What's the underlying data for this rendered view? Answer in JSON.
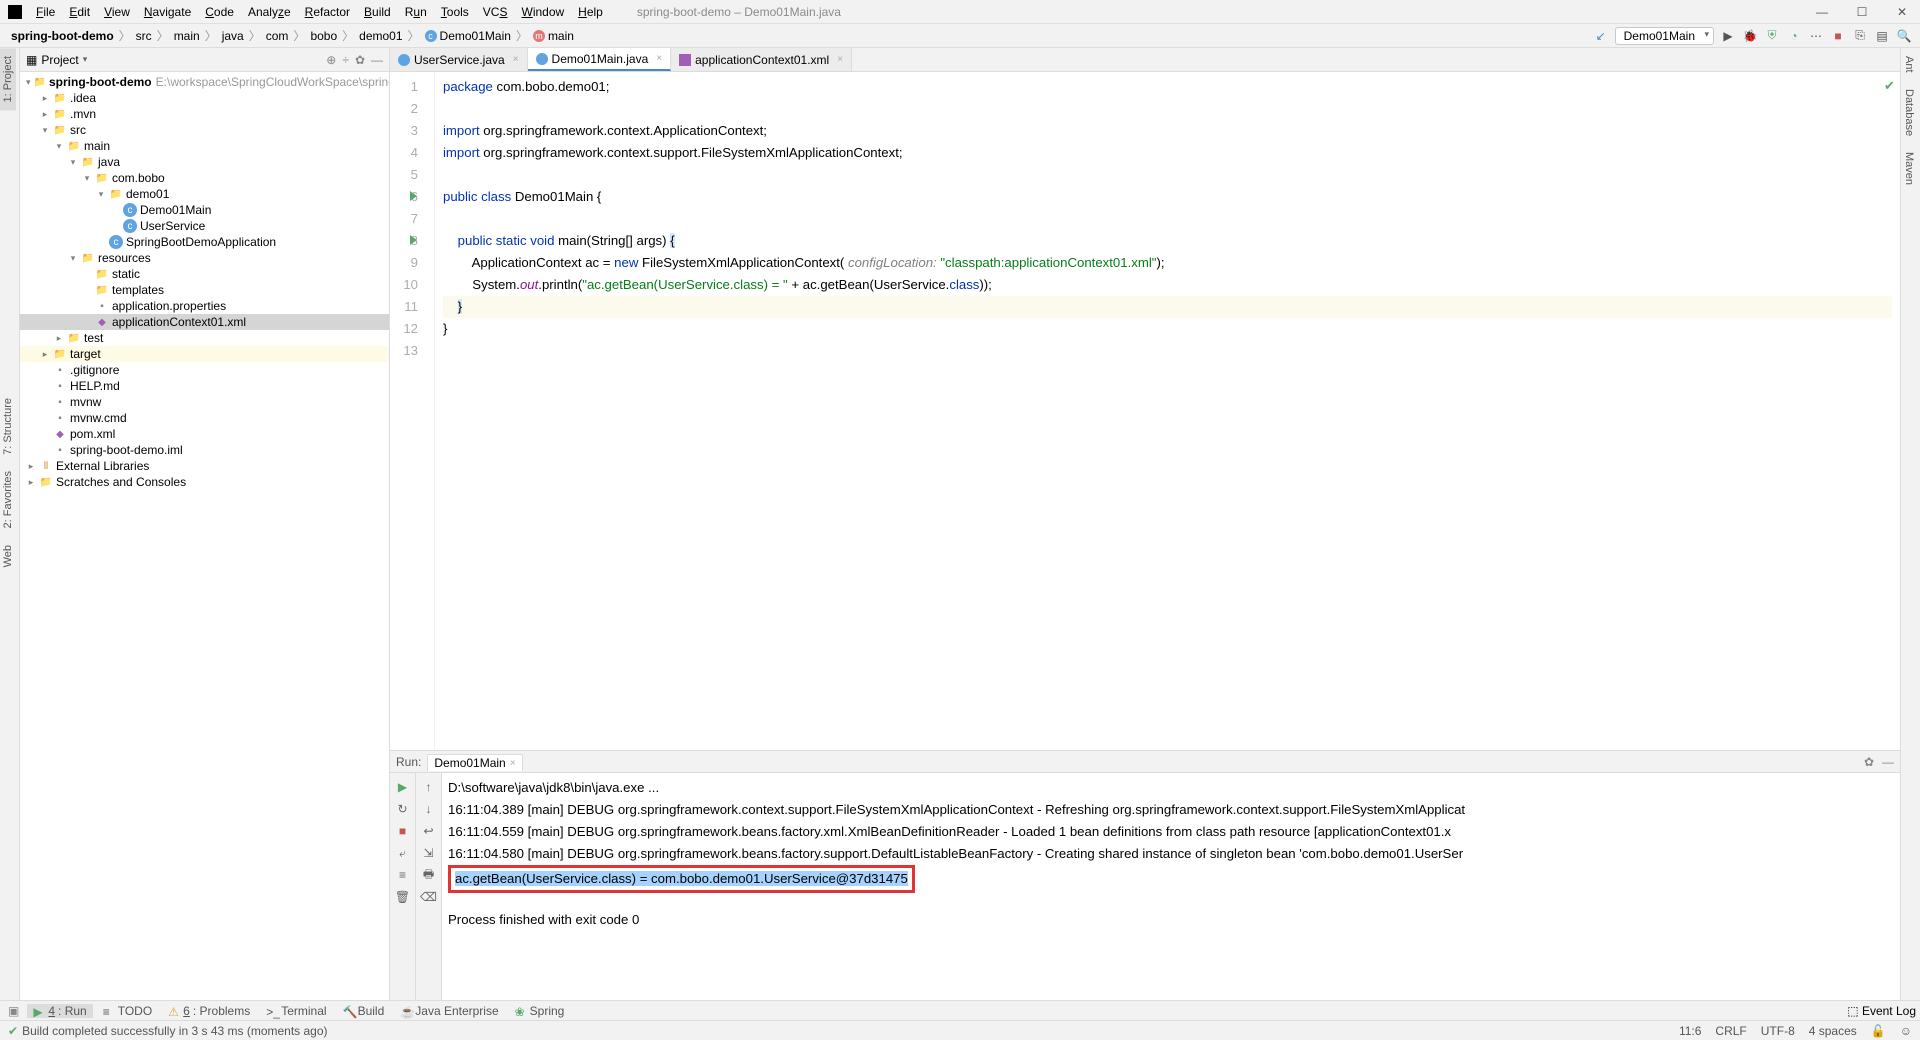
{
  "title": "spring-boot-demo – Demo01Main.java",
  "menus": [
    "File",
    "Edit",
    "View",
    "Navigate",
    "Code",
    "Analyze",
    "Refactor",
    "Build",
    "Run",
    "Tools",
    "VCS",
    "Window",
    "Help"
  ],
  "breadcrumb": {
    "project": "spring-boot-demo",
    "parts": [
      "src",
      "main",
      "java",
      "com",
      "bobo",
      "demo01"
    ],
    "class": "Demo01Main",
    "method": "main"
  },
  "run_config": "Demo01Main",
  "left_vtabs": [
    "1: Project",
    "7: Structure",
    "2: Favorites",
    "Web"
  ],
  "right_vtabs": [
    "Ant",
    "Database",
    "Maven"
  ],
  "project_panel": {
    "title": "Project"
  },
  "tree": [
    {
      "indent": 0,
      "exp": "▾",
      "icontype": "folder",
      "label": "spring-boot-demo",
      "path": "E:\\workspace\\SpringCloudWorkSpace\\spring-boot-d",
      "bold": true
    },
    {
      "indent": 1,
      "exp": "▸",
      "icontype": "folder",
      "label": ".idea"
    },
    {
      "indent": 1,
      "exp": "▸",
      "icontype": "folder",
      "label": ".mvn"
    },
    {
      "indent": 1,
      "exp": "▾",
      "icontype": "folder-blue",
      "label": "src"
    },
    {
      "indent": 2,
      "exp": "▾",
      "icontype": "folder",
      "label": "main"
    },
    {
      "indent": 3,
      "exp": "▾",
      "icontype": "folder-blue",
      "label": "java"
    },
    {
      "indent": 4,
      "exp": "▾",
      "icontype": "folder",
      "label": "com.bobo"
    },
    {
      "indent": 5,
      "exp": "▾",
      "icontype": "folder",
      "label": "demo01"
    },
    {
      "indent": 6,
      "exp": "",
      "icontype": "class",
      "label": "Demo01Main"
    },
    {
      "indent": 6,
      "exp": "",
      "icontype": "class",
      "label": "UserService"
    },
    {
      "indent": 5,
      "exp": "",
      "icontype": "class",
      "label": "SpringBootDemoApplication"
    },
    {
      "indent": 3,
      "exp": "▾",
      "icontype": "folder-orange",
      "label": "resources"
    },
    {
      "indent": 4,
      "exp": "",
      "icontype": "folder",
      "label": "static"
    },
    {
      "indent": 4,
      "exp": "",
      "icontype": "folder",
      "label": "templates"
    },
    {
      "indent": 4,
      "exp": "",
      "icontype": "file",
      "label": "application.properties"
    },
    {
      "indent": 4,
      "exp": "",
      "icontype": "xml",
      "label": "applicationContext01.xml",
      "selected": true
    },
    {
      "indent": 2,
      "exp": "▸",
      "icontype": "folder",
      "label": "test"
    },
    {
      "indent": 1,
      "exp": "▸",
      "icontype": "folder-orange",
      "label": "target",
      "warnbg": true
    },
    {
      "indent": 1,
      "exp": "",
      "icontype": "file",
      "label": ".gitignore"
    },
    {
      "indent": 1,
      "exp": "",
      "icontype": "file",
      "label": "HELP.md"
    },
    {
      "indent": 1,
      "exp": "",
      "icontype": "file",
      "label": "mvnw"
    },
    {
      "indent": 1,
      "exp": "",
      "icontype": "file",
      "label": "mvnw.cmd"
    },
    {
      "indent": 1,
      "exp": "",
      "icontype": "xml",
      "label": "pom.xml"
    },
    {
      "indent": 1,
      "exp": "",
      "icontype": "file",
      "label": "spring-boot-demo.iml"
    },
    {
      "indent": 0,
      "exp": "▸",
      "icontype": "lib",
      "label": "External Libraries"
    },
    {
      "indent": 0,
      "exp": "▸",
      "icontype": "folder",
      "label": "Scratches and Consoles"
    }
  ],
  "editor_tabs": [
    {
      "name": "UserService.java",
      "type": "cl"
    },
    {
      "name": "Demo01Main.java",
      "type": "cl",
      "active": true
    },
    {
      "name": "applicationContext01.xml",
      "type": "xm"
    }
  ],
  "code": {
    "lines": [
      {
        "n": 1,
        "type": "pkg"
      },
      {
        "n": 2,
        "type": "blank"
      },
      {
        "n": 3,
        "type": "imp1"
      },
      {
        "n": 4,
        "type": "imp2"
      },
      {
        "n": 5,
        "type": "blank"
      },
      {
        "n": 6,
        "type": "class",
        "run": true
      },
      {
        "n": 7,
        "type": "blank"
      },
      {
        "n": 8,
        "type": "main",
        "run": true
      },
      {
        "n": 9,
        "type": "ac"
      },
      {
        "n": 10,
        "type": "sout"
      },
      {
        "n": 11,
        "type": "close1",
        "hl": true
      },
      {
        "n": 12,
        "type": "close2"
      },
      {
        "n": 13,
        "type": "blank"
      }
    ],
    "pkg_kw": "package",
    "pkg_val": " com.bobo.demo01;",
    "imp_kw": "import",
    "imp1_val": " org.springframework.context.ApplicationContext;",
    "imp2_val": " org.springframework.context.support.FileSystemXmlApplicationContext;",
    "class_decl_kw": "public class ",
    "class_name": "Demo01Main {",
    "main_kw1": "public static void ",
    "main_name": "main",
    "main_args": "(String[] args) ",
    "main_brace": "{",
    "ac_line_pre": "        ApplicationContext ac = ",
    "ac_new": "new",
    "ac_ctor": " FileSystemXmlApplicationContext( ",
    "ac_param": "configLocation:",
    "ac_str": " \"classpath:applicationContext01.xml\"",
    "ac_end": ");",
    "sout_pre": "        System.",
    "sout_out": "out",
    "sout_mid": ".println(",
    "sout_str": "\"ac.getBean(UserService.class) = \"",
    "sout_post": " + ac.getBean(UserService.",
    "sout_cls": "class",
    "sout_end": "));",
    "close1": "    ",
    "close1_brace": "}",
    "close2": "}"
  },
  "run_panel": {
    "label": "Run:",
    "tab": "Demo01Main"
  },
  "console": [
    "D:\\software\\java\\jdk8\\bin\\java.exe ...",
    "16:11:04.389 [main] DEBUG org.springframework.context.support.FileSystemXmlApplicationContext - Refreshing org.springframework.context.support.FileSystemXmlApplicat",
    "16:11:04.559 [main] DEBUG org.springframework.beans.factory.xml.XmlBeanDefinitionReader - Loaded 1 bean definitions from class path resource [applicationContext01.x",
    "16:11:04.580 [main] DEBUG org.springframework.beans.factory.support.DefaultListableBeanFactory - Creating shared instance of singleton bean 'com.bobo.demo01.UserSer",
    "ac.getBean(UserService.class) = com.bobo.demo01.UserService@37d31475",
    "",
    "Process finished with exit code 0"
  ],
  "bottom_tabs": [
    {
      "icon": "▶",
      "label": "4: Run",
      "u": "R",
      "active": true
    },
    {
      "icon": "≡",
      "label": "TODO"
    },
    {
      "icon": "⚠",
      "label": "6: Problems"
    },
    {
      "icon": ">_",
      "label": "Terminal"
    },
    {
      "icon": "🔨",
      "label": "Build"
    },
    {
      "icon": "☕",
      "label": "Java Enterprise"
    },
    {
      "icon": "❀",
      "label": "Spring"
    }
  ],
  "event_log": "Event Log",
  "status": {
    "msg": "Build completed successfully in 3 s 43 ms (moments ago)",
    "pos": "11:6",
    "crlf": "CRLF",
    "enc": "UTF-8",
    "indent": "4 spaces"
  }
}
